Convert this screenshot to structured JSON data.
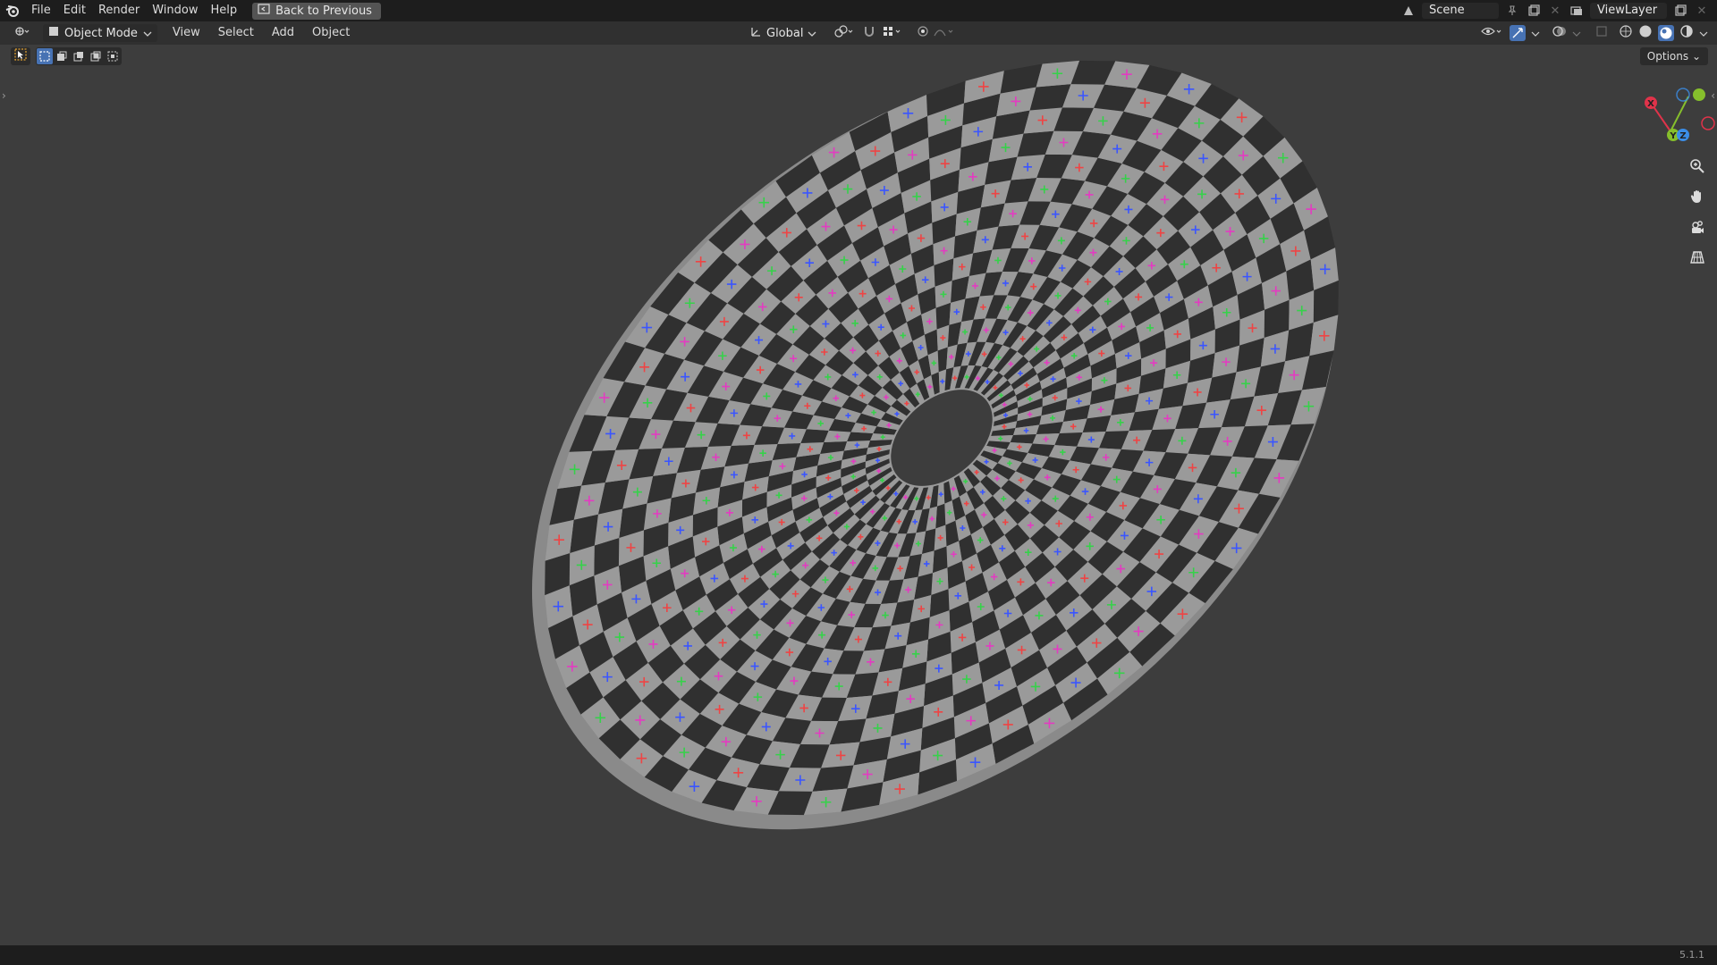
{
  "topbar": {
    "menu": [
      "File",
      "Edit",
      "Render",
      "Window",
      "Help"
    ],
    "back_button": "Back to Previous",
    "scene_name": "Scene",
    "view_layer_name": "ViewLayer"
  },
  "viewport_header": {
    "mode": "Object Mode",
    "menus": [
      "View",
      "Select",
      "Add",
      "Object"
    ],
    "orientation": "Global"
  },
  "options_label": "Options",
  "version": "5.1.1",
  "gizmo": {
    "axis_x": "X",
    "axis_y": "Y",
    "axis_z": "Z",
    "colors": {
      "x": "#e0334a",
      "y": "#86bf2c",
      "z": "#3b8ee8"
    }
  },
  "icons": {
    "logo": "blender-logo-icon",
    "back": "back-arrow-icon",
    "editor_type": "3d-viewport-icon",
    "mode": "object-mode-icon",
    "transform_orientation": "transform-icon",
    "pivot": "pivot-icon",
    "snap": "magnet-icon",
    "proportional": "proportional-icon",
    "visibility": "visibility-icon",
    "gizmo_toggle": "gizmo-icon",
    "overlays": "overlay-icon",
    "xray": "xray-icon",
    "shading_wire": "wireframe-shading-icon",
    "shading_solid": "solid-shading-icon",
    "shading_material": "material-shading-icon",
    "shading_rendered": "rendered-shading-icon",
    "zoom": "zoom-icon",
    "pan": "hand-icon",
    "camera": "camera-icon",
    "ortho": "grid-icon"
  },
  "viewport": {
    "background": "#3d3d3d",
    "checker_light": "#9a9a9a",
    "checker_dark": "#303030",
    "marker_colors": [
      "#ff9f1a",
      "#e33bc1",
      "#3bd6e3",
      "#36d14a",
      "#6b46ff",
      "#ee4444",
      "#8be34a",
      "#3a55ff"
    ]
  }
}
